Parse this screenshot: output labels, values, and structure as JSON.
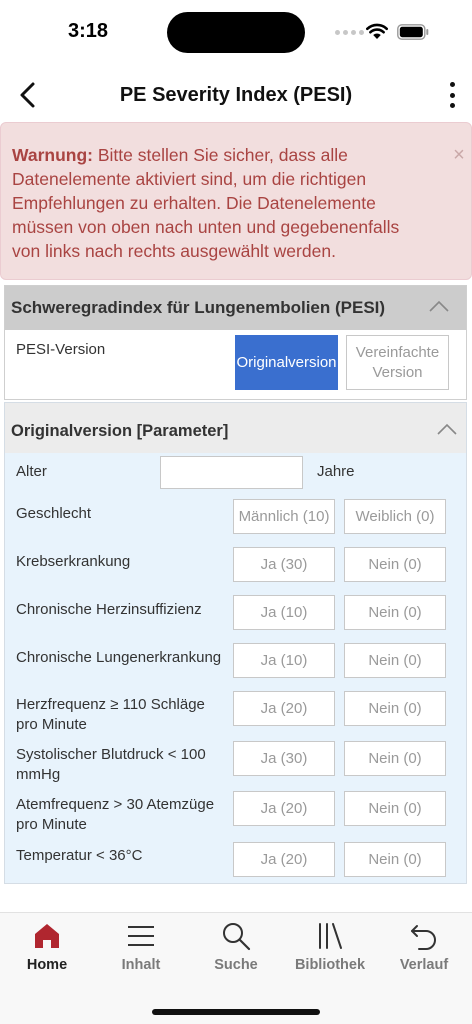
{
  "status_bar": {
    "time": "3:18"
  },
  "nav": {
    "title": "PE Severity Index (PESI)"
  },
  "warning": {
    "title": "Warnung:",
    "text": " Bitte stellen Sie sicher, dass alle Datenelemente aktiviert sind, um die richtigen Empfehlungen zu erhalten. Die Datenelemente müssen von oben nach unten und gegebenenfalls von links nach rechts ausgewählt werden.",
    "close": "×"
  },
  "section_main": {
    "title": "Schweregradindex für Lungenembolien (PESI)",
    "version_label": "PESI-Version",
    "version_options": [
      "Originalversion",
      "Vereinfachte Version"
    ],
    "selected": "Originalversion"
  },
  "section_params": {
    "title": "Originalversion [Parameter]",
    "age": {
      "label": "Alter",
      "value": "",
      "placeholder": "",
      "unit": "Jahre"
    },
    "rows": [
      {
        "label": "Geschlecht",
        "options": [
          "Männlich (10)",
          "Weiblich (0)"
        ]
      },
      {
        "label": "Krebserkrankung",
        "options": [
          "Ja (30)",
          "Nein (0)"
        ]
      },
      {
        "label": "Chronische Herzinsuffizienz",
        "options": [
          "Ja (10)",
          "Nein (0)"
        ]
      },
      {
        "label": "Chronische Lungenerkrankung",
        "options": [
          "Ja (10)",
          "Nein (0)"
        ]
      },
      {
        "label": "Herzfrequenz ≥ 110 Schläge pro Minute",
        "options": [
          "Ja (20)",
          "Nein (0)"
        ]
      },
      {
        "label": "Systolischer Blutdruck < 100 mmHg",
        "options": [
          "Ja (30)",
          "Nein (0)"
        ]
      },
      {
        "label": "Atemfrequenz > 30 Atemzüge pro Minute",
        "options": [
          "Ja (20)",
          "Nein (0)"
        ]
      },
      {
        "label": "Temperatur < 36°C",
        "options": [
          "Ja (20)",
          "Nein (0)"
        ]
      }
    ]
  },
  "tabs": [
    {
      "label": "Home",
      "icon": "home-icon",
      "active": true
    },
    {
      "label": "Inhalt",
      "icon": "menu-icon",
      "active": false
    },
    {
      "label": "Suche",
      "icon": "search-icon",
      "active": false
    },
    {
      "label": "Bibliothek",
      "icon": "library-icon",
      "active": false
    },
    {
      "label": "Verlauf",
      "icon": "history-icon",
      "active": false
    }
  ],
  "colors": {
    "accent": "#3a6fcf",
    "warning_bg": "#f2dede",
    "warning_text": "#a94442",
    "home_active": "#b0262f",
    "params_bg": "#e8f3fc"
  }
}
